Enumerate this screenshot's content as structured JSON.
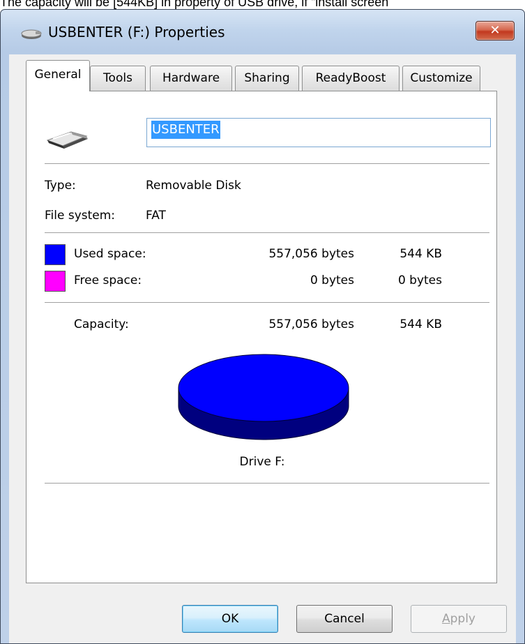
{
  "caption": "The capacity will be [544KB] in property of USB drive, if “install screen",
  "window": {
    "title": "USBENTER (F:) Properties",
    "close_glyph": "✕"
  },
  "tabs": [
    {
      "label": "General",
      "active": true
    },
    {
      "label": "Tools"
    },
    {
      "label": "Hardware"
    },
    {
      "label": "Sharing"
    },
    {
      "label": "ReadyBoost"
    },
    {
      "label": "Customize"
    }
  ],
  "general": {
    "volume_label": "USBENTER",
    "type_label": "Type:",
    "type_value": "Removable Disk",
    "fs_label": "File system:",
    "fs_value": "FAT",
    "used": {
      "label": "Used space:",
      "bytes": "557,056 bytes",
      "size": "544 KB",
      "color": "#0000ff"
    },
    "free": {
      "label": "Free space:",
      "bytes": "0 bytes",
      "size": "0 bytes",
      "color": "#ff00ff"
    },
    "capacity": {
      "label": "Capacity:",
      "bytes": "557,056 bytes",
      "size": "544 KB"
    },
    "drive_caption": "Drive F:",
    "used_fraction": 1.0
  },
  "buttons": {
    "ok": "OK",
    "cancel": "Cancel",
    "apply_first": "A",
    "apply_rest": "pply"
  },
  "icons": {
    "title": "usb-drive-icon",
    "drive": "usb-drive-icon"
  }
}
